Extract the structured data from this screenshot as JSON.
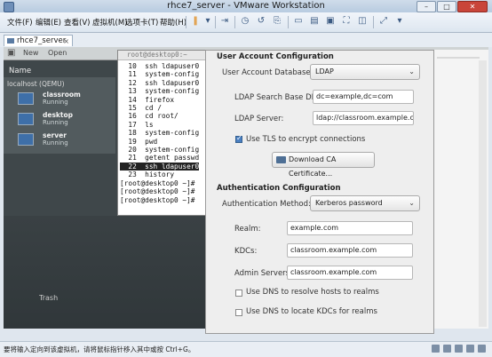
{
  "window": {
    "title": "rhce7_server - VMware Workstation"
  },
  "menubar": {
    "items": [
      "文件(F)",
      "编辑(E)",
      "查看(V)",
      "虚拟机(M)",
      "选项卡(T)",
      "帮助(H)"
    ]
  },
  "tabs": [
    {
      "label": "rhce7_server",
      "close": "×"
    }
  ],
  "guest_toolbar": {
    "new_label": "New",
    "open_label": "Open"
  },
  "vm_manager": {
    "header": "Name",
    "host": "localhost (QEMU)",
    "vms": [
      {
        "name": "classroom",
        "state": "Running"
      },
      {
        "name": "desktop",
        "state": "Running"
      },
      {
        "name": "server",
        "state": "Running"
      }
    ]
  },
  "terminal": {
    "title": "root@desktop0:~",
    "lines": [
      "  10  ssh ldapuser0",
      "  11  system-config",
      "  12  ssh ldapuser0",
      "  13  system-config",
      "  14  firefox",
      "  15  cd /",
      "  16  cd root/",
      "  17  ls",
      "  18  system-config",
      "  19  pwd",
      "  20  system-config",
      "  21  getent passwd",
      "  22  ssh ldapuser0",
      "  23  history",
      "[root@desktop0 ~]# ",
      "[root@desktop0 ~]# ",
      "[root@desktop0 ~]# "
    ],
    "highlight_index": 12
  },
  "desktop": {
    "trash_label": "Trash"
  },
  "user_account": {
    "section_title": "User Account Configuration",
    "database_label": "User Account Database:",
    "database_value": "LDAP",
    "search_base_label": "LDAP Search Base DN:",
    "search_base_value": "dc=example,dc=com",
    "server_label": "LDAP Server:",
    "server_value": "ldap://classroom.example.com",
    "tls_label": "Use TLS to encrypt connections",
    "tls_checked": true,
    "download_ca_label": "Download CA Certificate..."
  },
  "auth": {
    "section_title": "Authentication Configuration",
    "method_label": "Authentication Method:",
    "method_value": "Kerberos password",
    "realm_label": "Realm:",
    "realm_value": "example.com",
    "kdcs_label": "KDCs:",
    "kdcs_value": "classroom.example.com",
    "admin_label": "Admin Servers:",
    "admin_value": "classroom.example.com",
    "dns_realm_label": "Use DNS to resolve hosts to realms",
    "dns_kdc_label": "Use DNS to locate KDCs for realms"
  },
  "statusbar": {
    "text": "要将输入定向到该虚拟机，请将鼠标指针移入其中或按 Ctrl+G。"
  },
  "icons": [
    "app-icon",
    "minimize-icon",
    "maximize-icon",
    "close-icon",
    "pause-icon",
    "snapshot-icon",
    "fullscreen-icon",
    "vm-icon",
    "checkbox-icon",
    "download-icon",
    "keyboard-icon",
    "network-icon"
  ]
}
